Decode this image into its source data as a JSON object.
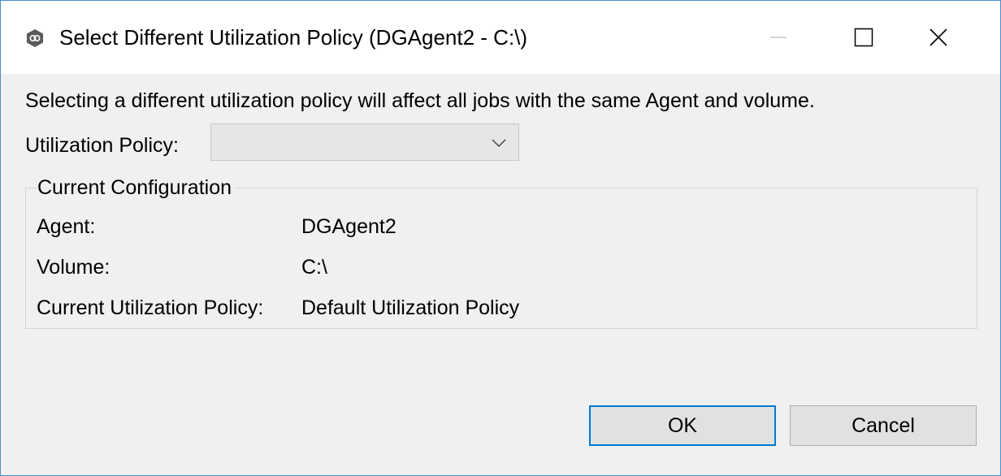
{
  "window": {
    "title": "Select Different Utilization Policy (DGAgent2 - C:\\)",
    "icon": "peer-software-app-icon",
    "controls": [
      "minimize-icon",
      "maximize-icon",
      "close-icon"
    ]
  },
  "message": "Selecting a different utilization policy will affect all jobs with the same Agent and volume.",
  "policy": {
    "label": "Utilization Policy:",
    "selected_value": ""
  },
  "current_configuration": {
    "legend": "Current Configuration",
    "rows": [
      {
        "label": "Agent:",
        "value": "DGAgent2"
      },
      {
        "label": "Volume:",
        "value": "C:\\"
      },
      {
        "label": "Current Utilization Policy:",
        "value": "Default Utilization Policy"
      }
    ]
  },
  "buttons": {
    "ok_label": "OK",
    "cancel_label": "Cancel"
  },
  "colors": {
    "window_border": "#4a90c8",
    "dialog_background": "#f0f0f0",
    "default_button_border": "#0078d7"
  }
}
